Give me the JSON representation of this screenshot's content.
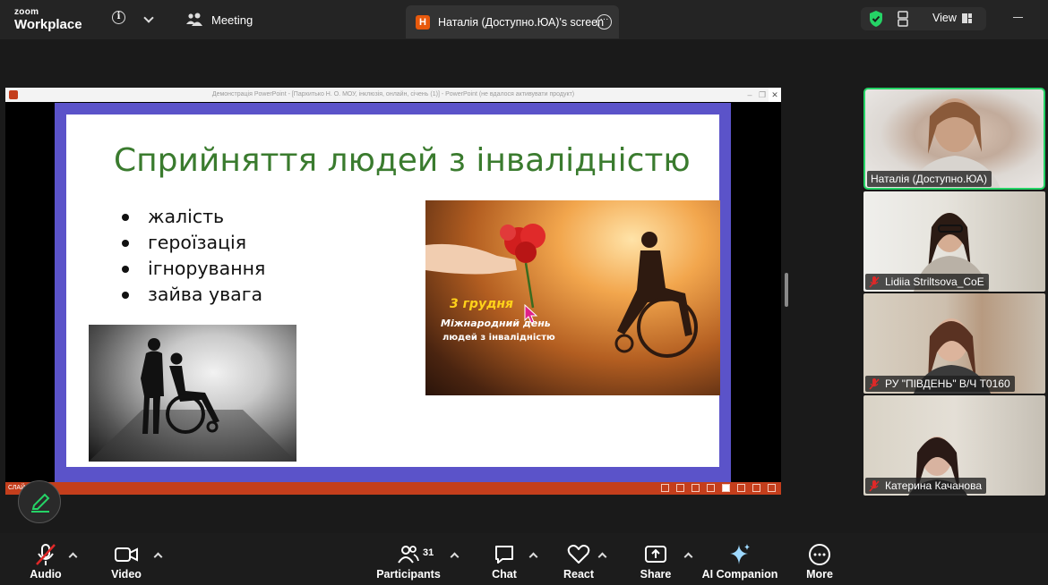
{
  "app": {
    "logo_line1": "zoom",
    "logo_line2": "Workplace",
    "info_icon": "i"
  },
  "header": {
    "meeting_label": "Meeting",
    "screen_tab": {
      "avatar_letter": "H",
      "label": "Наталія (Доступно.ЮА)'s screen"
    },
    "view_label": "View"
  },
  "shared_screen": {
    "window_title": "Демонстрація PowerPoint - [Пархитько Н. О. МОУ, інклюзія, онлайн, січень (1)] - PowerPoint (не вдалося активувати продукт)",
    "status_left": "СЛАЙ",
    "slide": {
      "title": "Сприйняття людей з інвалідністю",
      "bullets": [
        "жалість",
        "героїзація",
        "ігнорування",
        "зайва увага"
      ],
      "image_caption": {
        "date": "3 грудня",
        "line1": "Міжнародний день",
        "line2": "людей з інвалідністю"
      }
    }
  },
  "participants": [
    {
      "name": "Наталія (Доступно.ЮА)",
      "muted": false,
      "active": true
    },
    {
      "name": "Lidiia Striltsova_CoE",
      "muted": true,
      "active": false
    },
    {
      "name": "РУ \"ПІВДЕНЬ\" В/Ч Т0160",
      "muted": true,
      "active": false
    },
    {
      "name": "Катерина Качанова",
      "muted": true,
      "active": false
    }
  ],
  "toolbar": {
    "audio": "Audio",
    "video": "Video",
    "participants": "Participants",
    "participants_count": "31",
    "chat": "Chat",
    "react": "React",
    "share": "Share",
    "ai_companion": "AI Companion",
    "more": "More"
  },
  "colors": {
    "accent_green": "#25d366",
    "slide_title_green": "#3a7b2e",
    "slide_frame_purple": "#5b53c9",
    "powerpoint_orange": "#c43e1c",
    "muted_red": "#e02828",
    "screen_avatar_orange": "#e8590c"
  }
}
